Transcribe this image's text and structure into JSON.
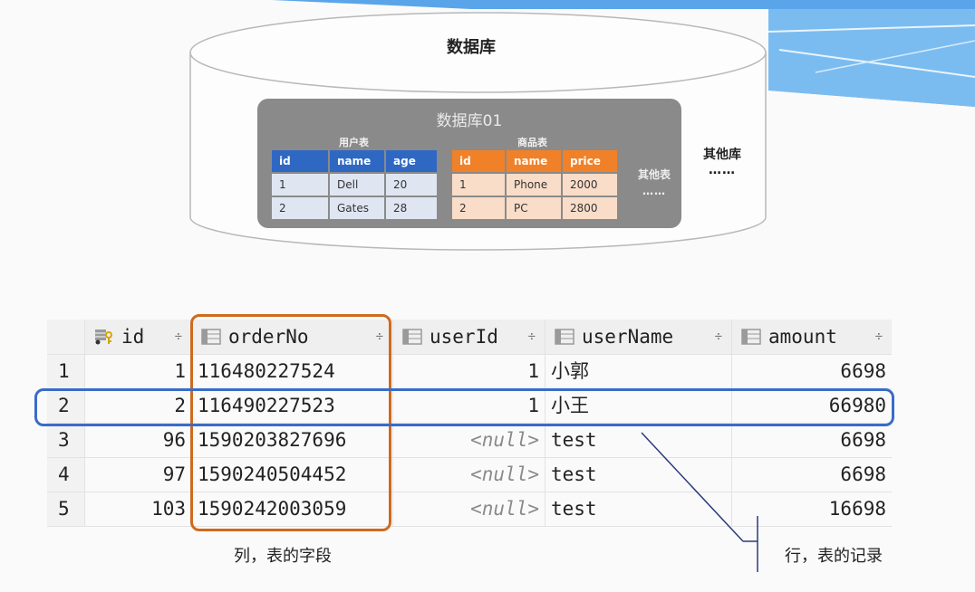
{
  "database": {
    "title": "数据库",
    "db01_title": "数据库01",
    "users_table": {
      "caption": "用户表",
      "columns": [
        "id",
        "name",
        "age"
      ],
      "rows": [
        [
          "1",
          "Dell",
          "20"
        ],
        [
          "2",
          "Gates",
          "28"
        ]
      ]
    },
    "goods_table": {
      "caption": "商品表",
      "columns": [
        "id",
        "name",
        "price"
      ],
      "rows": [
        [
          "1",
          "Phone",
          "2000"
        ],
        [
          "2",
          "PC",
          "2800"
        ]
      ]
    },
    "other_tables": "其他表",
    "other_tables_dots": "……",
    "other_dbs": "其他库",
    "other_dbs_dots": "……"
  },
  "grid": {
    "columns": [
      {
        "key": "id",
        "label": "id",
        "sort": "÷",
        "icon": "primary-key-icon"
      },
      {
        "key": "orderNo",
        "label": "orderNo",
        "sort": "÷",
        "icon": "column-icon"
      },
      {
        "key": "userId",
        "label": "userId",
        "sort": "÷",
        "icon": "column-icon"
      },
      {
        "key": "userName",
        "label": "userName",
        "sort": "÷",
        "icon": "column-icon"
      },
      {
        "key": "amount",
        "label": "amount",
        "sort": "÷",
        "icon": "column-icon"
      }
    ],
    "rows": [
      {
        "rownum": "1",
        "id": "1",
        "orderNo": "116480227524",
        "userId": "1",
        "userName": "小郭",
        "amount": "6698"
      },
      {
        "rownum": "2",
        "id": "2",
        "orderNo": "116490227523",
        "userId": "1",
        "userName": "小王",
        "amount": "66980"
      },
      {
        "rownum": "3",
        "id": "96",
        "orderNo": "1590203827696",
        "userId": "<null>",
        "userName": "test",
        "amount": "6698"
      },
      {
        "rownum": "4",
        "id": "97",
        "orderNo": "1590240504452",
        "userId": "<null>",
        "userName": "test",
        "amount": "6698"
      },
      {
        "rownum": "5",
        "id": "103",
        "orderNo": "1590242003059",
        "userId": "<null>",
        "userName": "test",
        "amount": "16698"
      }
    ]
  },
  "annotations": {
    "column_note": "列，表的字段",
    "row_note": "行，表的记录"
  },
  "colors": {
    "users_header": "#2f68c3",
    "goods_header": "#f08129",
    "column_frame": "#cf6a1e",
    "row_frame": "#3a6cc7"
  }
}
